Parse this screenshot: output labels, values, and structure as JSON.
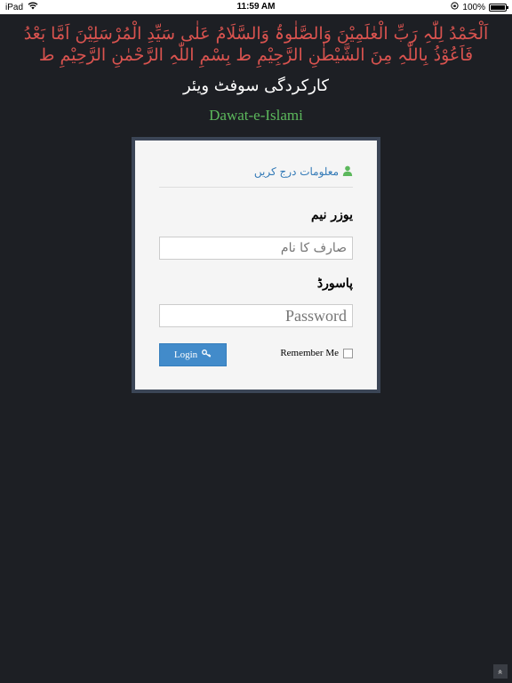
{
  "status_bar": {
    "device": "iPad",
    "time": "11:59 AM",
    "battery": "100%",
    "battery_level": 1.0
  },
  "header": {
    "dua": "اَلْحَمْدُ لِلّٰہِ رَبِّ الْعٰلَمِیْنَ وَالصَّلٰوۃُ وَالسَّلَامُ عَلٰی سَیِّدِ الْمُرْسَلِیْنَ اَمَّا بَعْدُ فَاَعُوْذُ بِاللّٰہِ مِنَ الشَّیْطٰنِ الرَّجِیْمِ ط بِسْمِ اللّٰہِ الرَّحْمٰنِ الرَّحِیْمِ ط",
    "software_name": "کارکردگی سوفٹ ویئر",
    "organization": "Dawat-e-Islami"
  },
  "login": {
    "heading": "معلومات درج کریں",
    "username_label": "یوزر نیم",
    "username_placeholder": "صارف کا نام",
    "password_label": "پاسورڈ",
    "password_placeholder": "Password",
    "login_button": "Login",
    "remember_me": "Remember Me"
  },
  "scroll_top": "»",
  "colors": {
    "background": "#1d1f24",
    "dua": "#d9534f",
    "organization": "#5cb85c",
    "heading": "#337ab7",
    "user_icon": "#5cb85c",
    "button": "#428bca"
  },
  "icons": {
    "wifi": "wifi-icon",
    "orientation_lock": "orientation-lock-icon",
    "battery": "battery-icon",
    "user": "user-icon",
    "key": "key-icon",
    "scroll_top": "chevrons-up-icon"
  }
}
